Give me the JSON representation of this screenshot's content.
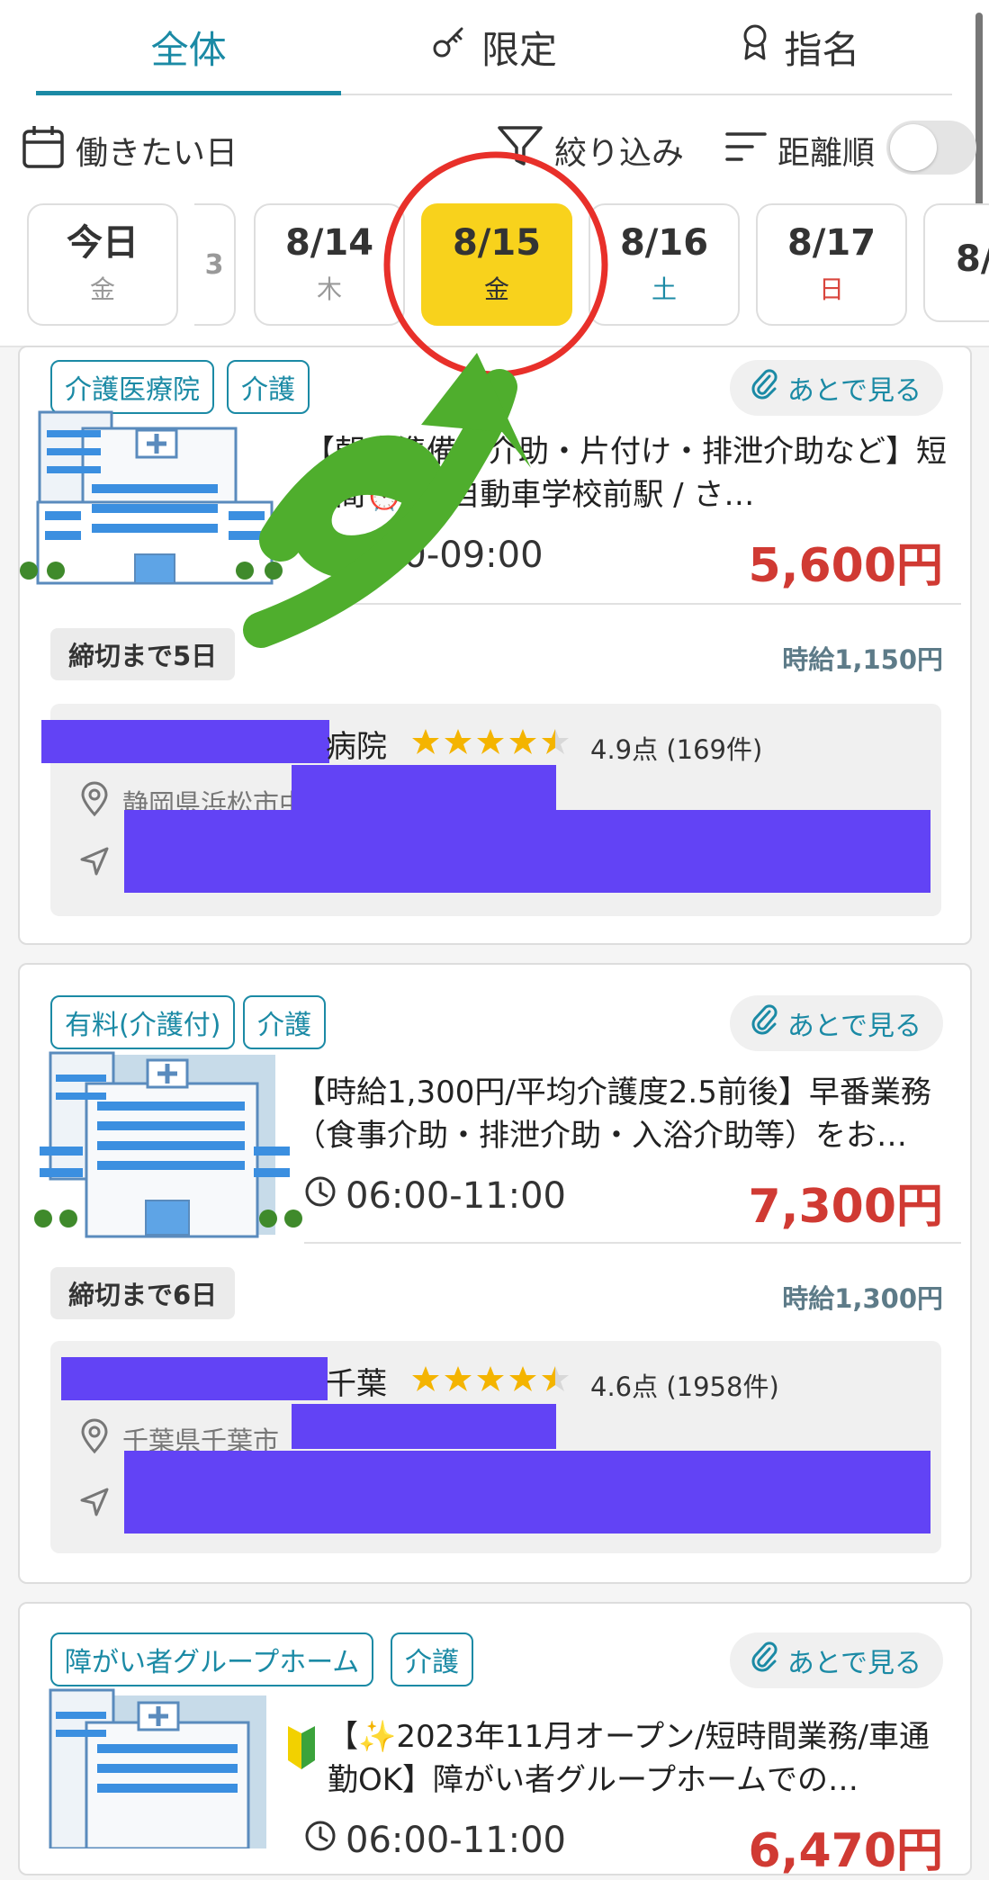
{
  "tabs": [
    {
      "label": "全体",
      "icon": "none",
      "active": true
    },
    {
      "label": "限定",
      "icon": "key-icon",
      "active": false
    },
    {
      "label": "指名",
      "icon": "award-ribbon-icon",
      "active": false
    }
  ],
  "filters": {
    "work_day_label": "働きたい日",
    "narrow_label": "絞り込み",
    "sort_label": "距離順",
    "sort_toggle_on": false
  },
  "dates": [
    {
      "date": "今日",
      "weekday": "金"
    },
    {
      "date": "8/14",
      "weekday": "木"
    },
    {
      "date": "8/15",
      "weekday": "金",
      "selected": true
    },
    {
      "date": "8/16",
      "weekday": "土"
    },
    {
      "date": "8/17",
      "weekday": "日"
    },
    {
      "date": "8/",
      "weekday": ""
    }
  ],
  "later_label": "あとで見る",
  "jobs": [
    {
      "tags": [
        "介護医療院",
        "介護"
      ],
      "title": "【朝食準備・介助・片付け・排泄介助など】短時間⏰】【自動車学校前駅 / さ…",
      "time": "6:00-09:00",
      "price": "5,600円",
      "deadline": "締切まで5日",
      "wage": "時給1,150円",
      "facility_name": "病院",
      "rating": "4.9点 (169件)",
      "address": "静岡県浜松市中"
    },
    {
      "tags": [
        "有料(介護付)",
        "介護"
      ],
      "title": "【時給1,300円/平均介護度2.5前後】早番業務（食事介助・排泄介助・入浴介助等）をお…",
      "time": "06:00-11:00",
      "price": "7,300円",
      "deadline": "締切まで6日",
      "wage": "時給1,300円",
      "facility_name": "千葉",
      "rating": "4.6点 (1958件)",
      "address": "千葉県千葉市"
    },
    {
      "tags": [
        "障がい者グループホーム",
        "介護"
      ],
      "title": "【✨2023年11月オープン/短時間業務/車通勤OK】障がい者グループホームでの…",
      "time": "06:00-11:00",
      "price": "6,470円"
    }
  ],
  "colors": {
    "accent": "#1b8aa5",
    "selected_date": "#f8d21c",
    "price": "#d03a33",
    "redaction": "#6243f5",
    "annotation_circle": "#e8302a",
    "annotation_arrow": "#4fae2d"
  }
}
